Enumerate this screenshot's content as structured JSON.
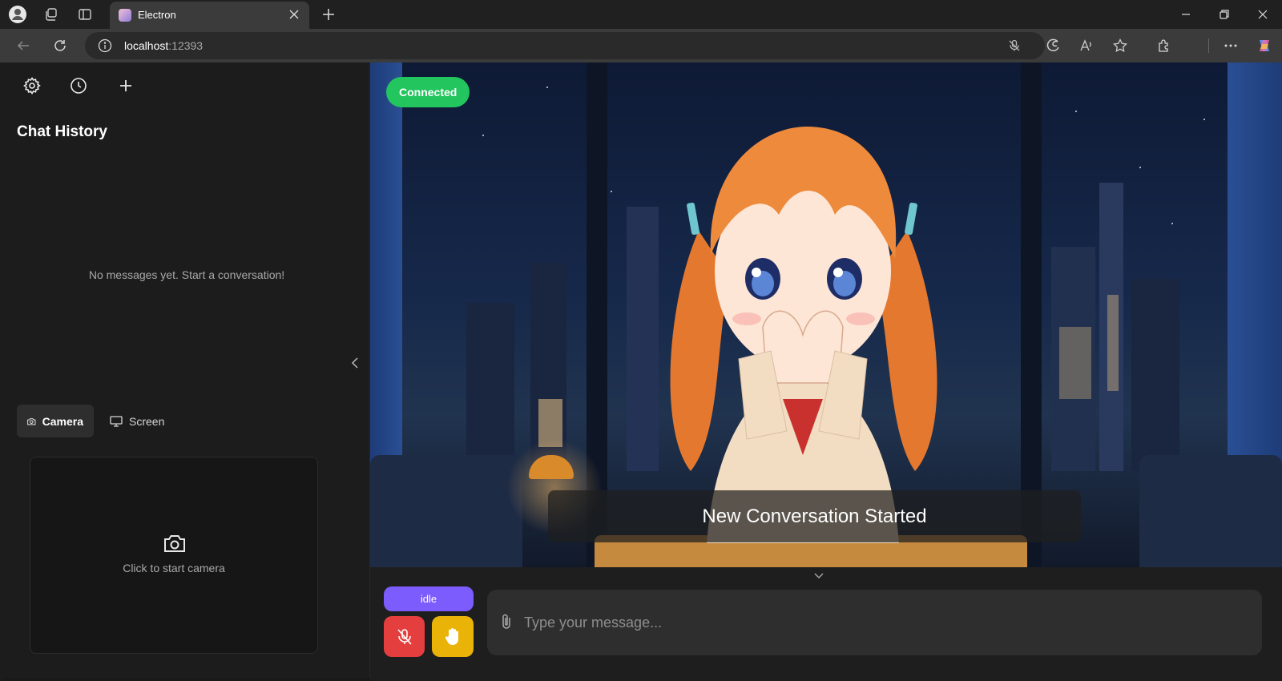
{
  "browser": {
    "tab_title": "Electron",
    "url_host": "localhost",
    "url_port": ":12393"
  },
  "sidebar": {
    "settings_icon": "gear-icon",
    "history_icon": "clock-icon",
    "new_chat_icon": "plus-icon",
    "chat_history_title": "Chat History",
    "empty_message": "No messages yet. Start a conversation!",
    "tabs": [
      {
        "label": "Camera",
        "icon": "camera-icon",
        "active": true
      },
      {
        "label": "Screen",
        "icon": "monitor-icon",
        "active": false
      }
    ],
    "camera_prompt": "Click to start camera"
  },
  "stage": {
    "status_badge": "Connected",
    "subtitle": "New Conversation Started"
  },
  "controls": {
    "state_label": "idle",
    "message_placeholder": "Type your message..."
  },
  "colors": {
    "connected": "#22c55e",
    "idle": "#7c5cfc",
    "mic": "#e53e3e",
    "hand": "#eab308"
  }
}
